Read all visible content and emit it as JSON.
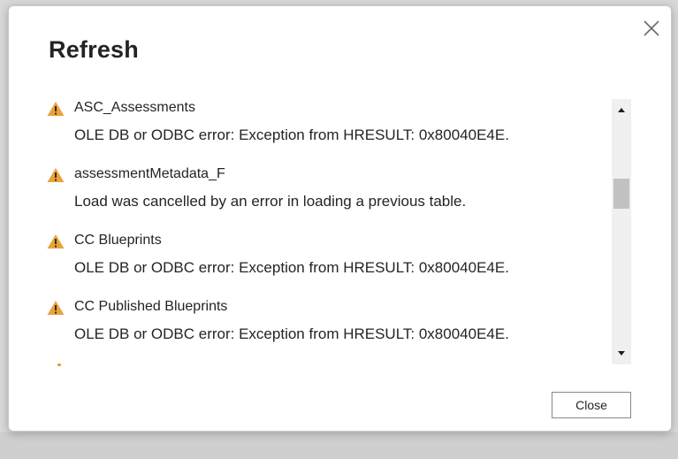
{
  "dialog": {
    "title": "Refresh",
    "close_label": "Close"
  },
  "colors": {
    "warning": "#e8a33d",
    "text": "#252423"
  },
  "items": [
    {
      "name": "ASC_Assessments",
      "message": "OLE DB or ODBC error: Exception from HRESULT: 0x80040E4E.",
      "icon": "warning-icon"
    },
    {
      "name": "assessmentMetadata_F",
      "message": "Load was cancelled by an error in loading a previous table.",
      "icon": "warning-icon"
    },
    {
      "name": "CC Blueprints",
      "message": "OLE DB or ODBC error: Exception from HRESULT: 0x80040E4E.",
      "icon": "warning-icon"
    },
    {
      "name": "CC Published Blueprints",
      "message": "OLE DB or ODBC error: Exception from HRESULT: 0x80040E4E.",
      "icon": "warning-icon"
    }
  ]
}
